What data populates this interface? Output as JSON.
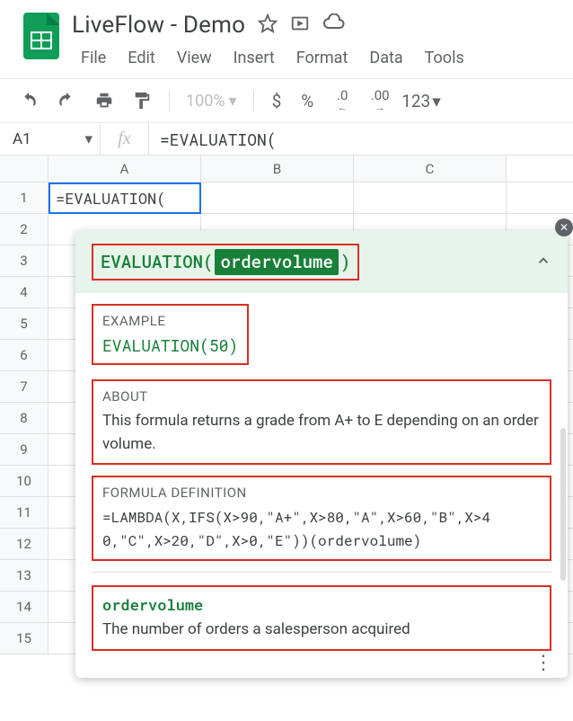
{
  "doc_title": "LiveFlow - Demo",
  "menus": [
    "File",
    "Edit",
    "View",
    "Insert",
    "Format",
    "Data",
    "Tools"
  ],
  "toolbar": {
    "zoom": "100%",
    "currency": "$",
    "percent": "%",
    "dec_dec": ".0",
    "dec_inc": ".00",
    "more_formats": "123"
  },
  "name_box": "A1",
  "fx_label": "fx",
  "formula_bar": "=EVALUATION(",
  "columns": [
    "A",
    "B",
    "C"
  ],
  "row_count": 15,
  "active_cell_text": "=EVALUATION(",
  "help": {
    "fn_name": "EVALUATION",
    "arg": "ordervolume",
    "example_label": "EXAMPLE",
    "example_text": "EVALUATION(50)",
    "about_label": "ABOUT",
    "about_text": "This formula returns a grade from A+ to E depending on an order volume.",
    "def_label": "FORMULA DEFINITION",
    "def_text": "=LAMBDA(X,IFS(X>90,\"A+\",X>80,\"A\",X>60,\"B\",X>40,\"C\",X>20,\"D\",X>0,\"E\"))(ordervolume)",
    "param_name": "ordervolume",
    "param_desc": "The number of orders a salesperson acquired"
  }
}
